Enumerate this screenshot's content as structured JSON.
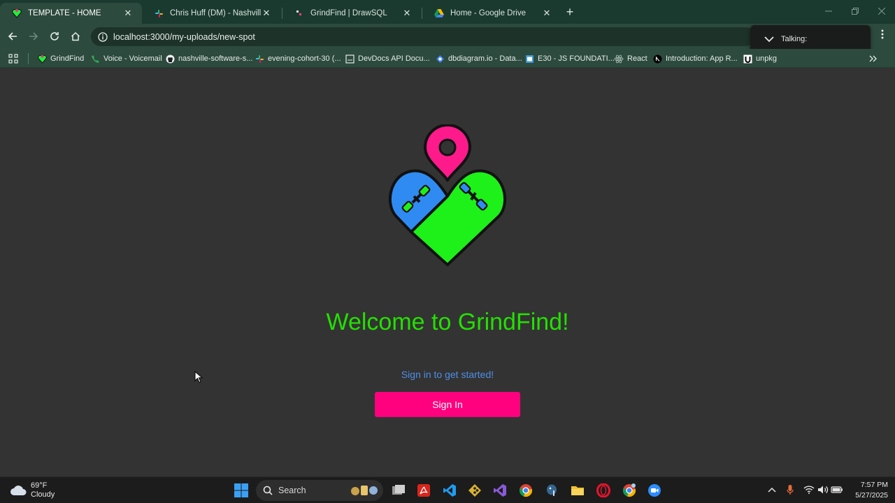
{
  "browser": {
    "tabs": [
      {
        "title": "TEMPLATE - HOME",
        "icon": "grindfind-favicon",
        "active": true
      },
      {
        "title": "Chris Huff (DM) - Nashville Soft",
        "icon": "slack-favicon",
        "active": false
      },
      {
        "title": "GrindFind | DrawSQL",
        "icon": "drawsql-favicon",
        "active": false
      },
      {
        "title": "Home - Google Drive",
        "icon": "google-drive-favicon",
        "active": false
      }
    ],
    "new_tab_symbol": "+",
    "tab_close_symbol": "✕",
    "url": "localhost:3000/my-uploads/new-spot",
    "talking_label": "Talking:"
  },
  "bookmarks": [
    {
      "label": "GrindFind",
      "icon": "grindfind-icon"
    },
    {
      "label": "Voice - Voicemail",
      "icon": "voice-icon"
    },
    {
      "label": "nashville-software-s...",
      "icon": "github-icon"
    },
    {
      "label": "evening-cohort-30 (...",
      "icon": "slack-icon"
    },
    {
      "label": "DevDocs API Docu...",
      "icon": "devdocs-icon"
    },
    {
      "label": "dbdiagram.io - Data...",
      "icon": "dbdiagram-icon"
    },
    {
      "label": "E30 - JS FOUNDATI...",
      "icon": "e30-icon"
    },
    {
      "label": "React",
      "icon": "react-icon"
    },
    {
      "label": "Introduction: App R...",
      "icon": "nextjs-icon"
    },
    {
      "label": "unpkg",
      "icon": "unpkg-icon"
    }
  ],
  "page": {
    "heading": "Welcome to GrindFind!",
    "subtitle": "Sign in to get started!",
    "signin_label": "Sign In"
  },
  "taskbar": {
    "weather_temp": "69°F",
    "weather_desc": "Cloudy",
    "search_label": "Search",
    "time": "7:57 PM",
    "date": "5/27/2025"
  },
  "colors": {
    "page_bg": "#333333",
    "heading": "#23e000",
    "subtitle": "#4e8fe6",
    "button": "#ff007f",
    "chrome_frame": "#1b3a2f",
    "chrome_toolbar": "#2d4a3e"
  }
}
